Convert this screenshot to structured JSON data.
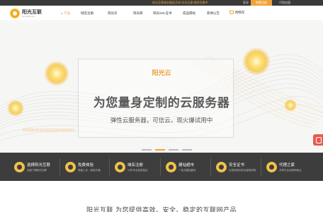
{
  "topbar": {
    "promo": "阳光互联域名服务活动“实名注册”限时优惠中",
    "login": "登录",
    "register": "免费注册",
    "agent": "代理加盟"
  },
  "header": {
    "brand": "阳光互联",
    "brand_sub": "sun-ygfw.com",
    "nav": [
      {
        "label": "产品",
        "active": true
      },
      {
        "label": "域名注册",
        "active": false
      },
      {
        "label": "阳光云",
        "active": false
      },
      {
        "label": "阳光邮",
        "active": false
      },
      {
        "label": "阳光SSL证书",
        "active": false
      },
      {
        "label": "成品网站",
        "active": false
      },
      {
        "label": "新闻公告",
        "active": false
      }
    ],
    "cart": "购物车"
  },
  "hero": {
    "small_title": "阳光云",
    "title": "为您量身定制的云服务器",
    "subtitle": "弹性云服务器，可信云，现火爆试用中",
    "binary": "0101010101010101010101",
    "accent_color": "#f0a23a"
  },
  "features": [
    {
      "title": "选择阳光互联",
      "desc": "全面了解阳光互联",
      "icon": "sun-icon"
    },
    {
      "title": "免费体验",
      "desc": "快速上手，轻松开通",
      "icon": "free-icon"
    },
    {
      "title": "域名注册",
      "desc": "12年专业品质保证",
      "icon": "globe-icon"
    },
    {
      "title": "建站超市",
      "desc": "一站式建站服务",
      "icon": "site-icon"
    },
    {
      "title": "安全证书",
      "desc": "为您的网站安全保驾护航",
      "icon": "shield-icon"
    },
    {
      "title": "代理之家",
      "desc": "共享平台互联网商业",
      "icon": "agent-icon"
    }
  ],
  "bottom": {
    "title": "阳光互联 为您提供高效、安全、稳定的互联网产品"
  }
}
